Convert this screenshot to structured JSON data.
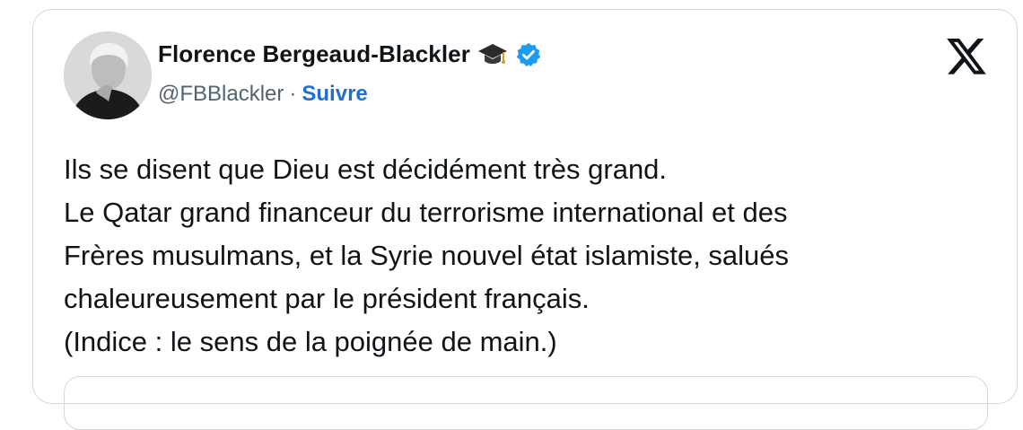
{
  "author": {
    "display_name": "Florence Bergeaud-Blackler",
    "handle": "@FBBlackler",
    "separator": "·",
    "follow_label": "Suivre",
    "badge_icons": [
      "graduation-cap-icon",
      "verified-badge-icon"
    ],
    "verified_color": "#1d9bf0"
  },
  "platform": {
    "logo_icon": "x-logo-icon"
  },
  "tweet": {
    "lines": [
      "Ils se disent que Dieu est décidément très grand.",
      "Le Qatar grand financeur du terrorisme international et des",
      "Frères musulmans, et la Syrie nouvel état islamiste, salués",
      "chaleureusement par le président français.",
      "(Indice : le sens de la poignée de main.)"
    ]
  },
  "colors": {
    "text": "#0f1419",
    "secondary": "#536471",
    "link": "#1d6fd6",
    "border": "#cfd9de"
  }
}
